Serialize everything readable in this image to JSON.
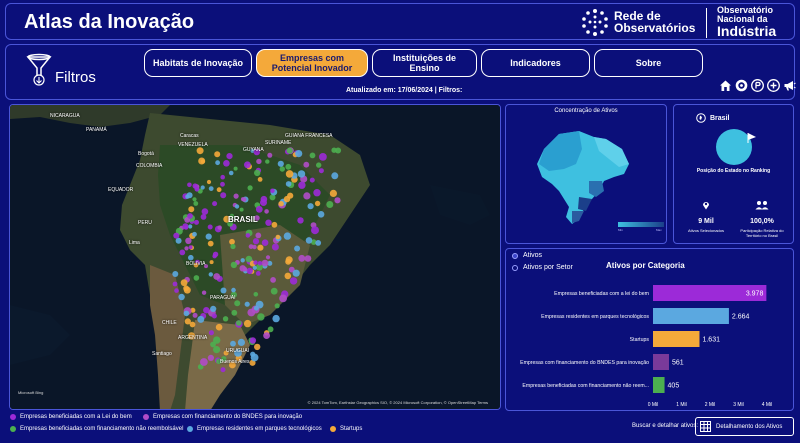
{
  "header": {
    "title": "Atlas da Inovação",
    "brand_rede_line1": "Rede de",
    "brand_rede_line2": "Observatórios",
    "brand_obs_line1": "Observatório",
    "brand_obs_line2": "Nacional da",
    "brand_obs_line3": "Indústria"
  },
  "nav": {
    "filter_label": "Filtros",
    "tabs": [
      {
        "label": "Habitats de Inovação",
        "active": false
      },
      {
        "label": "Empresas com Potencial Inovador",
        "active": true
      },
      {
        "label": "Instituições de Ensino",
        "active": false
      },
      {
        "label": "Indicadores",
        "active": false
      },
      {
        "label": "Sobre",
        "active": false
      }
    ],
    "updated_text": "Atualizado em: 17/06/2024 | Filtros:",
    "icons": [
      "home-icon",
      "info-icon",
      "pdf-icon",
      "plus-icon",
      "megaphone-icon"
    ]
  },
  "map": {
    "labels": {
      "venezuela": "VENEZUELA",
      "colombia": "COLOMBIA",
      "equador": "EQUADOR",
      "peru": "PERU",
      "brasil": "BRASIL",
      "bolivia": "BOLIVIA",
      "paraguai": "PARAGUAI",
      "chile": "CHILE",
      "argentina": "ARGENTINA",
      "uruguai": "URUGUAI",
      "lima": "Lima",
      "santiago": "Santiago",
      "buenos_aires": "Buenos Aires",
      "caracas": "Caracas",
      "bogota": "Bogotá",
      "guiana": "GUIANA FRANCESA",
      "suriname": "SURINAME",
      "guyana": "GUYANA",
      "panama": "PANAMÁ",
      "nicaragua": "NICARAGUA"
    },
    "credit": "© 2024 TomTom, Earthstar Geographics SIO, © 2024 Microsoft Corporation, © OpenStreetMap   Terms",
    "logo": "Microsoft Bing"
  },
  "legend": [
    {
      "label": "Empresas beneficiadas com a Lei do bem",
      "color": "#9c2ad8"
    },
    {
      "label": "Empresas com financiamento do BNDES para inovação",
      "color": "#b04cc8"
    },
    {
      "label": "Empresas beneficiadas com financiamento não reembolsável",
      "color": "#4caf50"
    },
    {
      "label": "Empresas residentes em parques tecnológicos",
      "color": "#5ba8e0"
    },
    {
      "label": "Startups",
      "color": "#f4a93a"
    }
  ],
  "mini_map": {
    "title": "Concentração de Ativos",
    "scale_min": "Min",
    "scale_max": "Max"
  },
  "state_card": {
    "name": "Brasil",
    "rank_label": "Posição do Estado no Ranking",
    "kpi1_value": "9 Mil",
    "kpi1_label": "Ativos Selecionados",
    "kpi2_value": "100,0%",
    "kpi2_label": "Participação Relativa do Território no Brasil"
  },
  "bar_panel": {
    "radio_ativos": "Ativos",
    "radio_setor": "Ativos por Setor",
    "title": "Ativos por Categoria"
  },
  "chart_data": {
    "type": "bar",
    "orientation": "horizontal",
    "title": "Ativos por Categoria",
    "categories": [
      "Empresas beneficiadas com a lei do bem",
      "Empresas residentes em parques tecnológicos",
      "Startups",
      "Empresas com financiamento do BNDES para inovação",
      "Empresas beneficiadas com financiamento não reem..."
    ],
    "values": [
      3978,
      2664,
      1631,
      561,
      405
    ],
    "value_labels": [
      "3.978",
      "2.664",
      "1.631",
      "561",
      "405"
    ],
    "colors": [
      "#9c2ad8",
      "#5ba8e0",
      "#f4a93a",
      "#7a3a9a",
      "#4caf50"
    ],
    "xlim": [
      0,
      4000
    ],
    "xticks": [
      0,
      1000,
      2000,
      3000,
      4000
    ],
    "xtick_labels": [
      "0 Mil",
      "1 Mil",
      "2 Mil",
      "3 Mil",
      "4 Mil"
    ]
  },
  "footer": {
    "search_text": "Buscar e detalhar ativos:",
    "detail_button": "Detalhamento dos Ativos"
  }
}
